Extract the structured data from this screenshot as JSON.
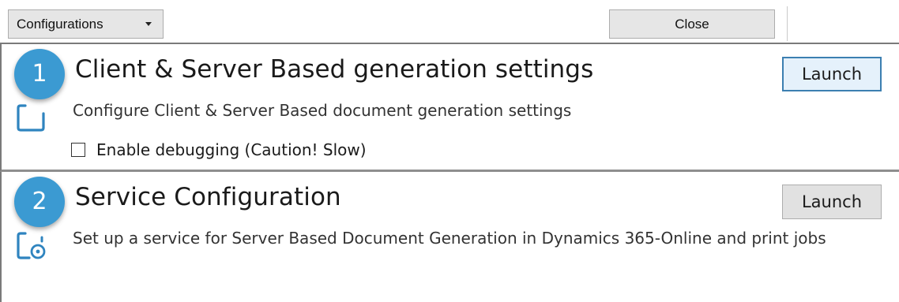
{
  "toolbar": {
    "configurations_label": "Configurations",
    "close_label": "Close"
  },
  "panels": [
    {
      "number": "1",
      "title": "Client & Server Based generation settings",
      "description": "Configure Client & Server Based document generation settings",
      "launch_label": "Launch",
      "icon": "document-icon",
      "debug_label": "Enable debugging (Caution! Slow)",
      "debug_checked": false
    },
    {
      "number": "2",
      "title": "Service Configuration",
      "description": "Set up a service for Server Based Document Generation in Dynamics 365-Online and print jobs",
      "launch_label": "Launch",
      "icon": "document-service-icon"
    }
  ],
  "colors": {
    "badge": "#3b9ad2",
    "icon_stroke": "#2f84bf",
    "focused_button_border": "#3c7fb1"
  }
}
